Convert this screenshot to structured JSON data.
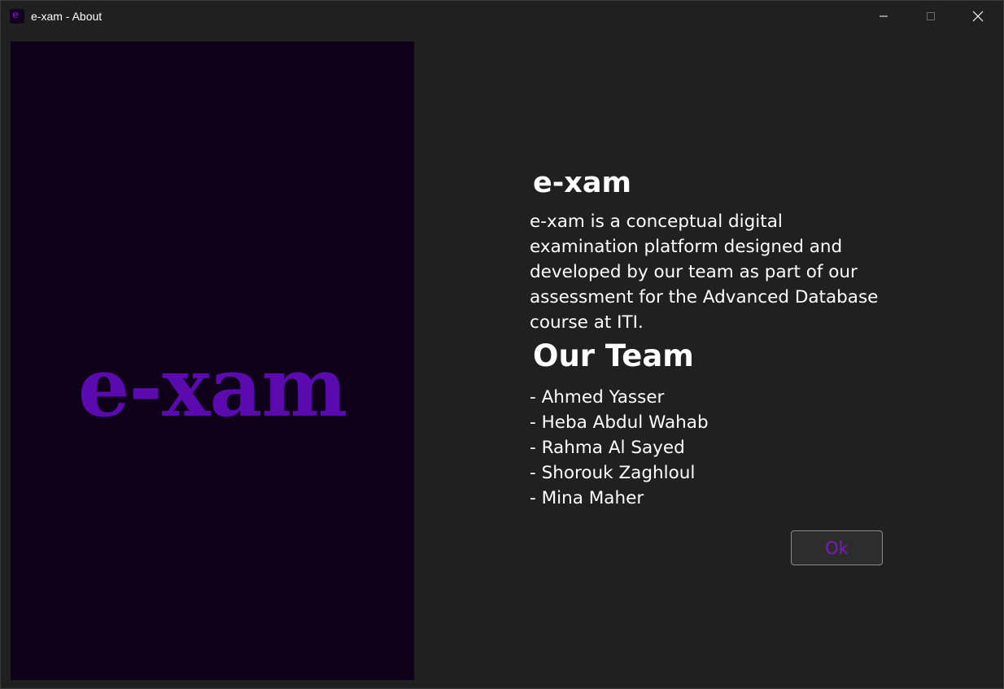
{
  "window": {
    "title": "e-xam - About",
    "app_icon_glyph": "e",
    "controls": [
      "minimize-icon",
      "maximize-icon",
      "close-icon"
    ]
  },
  "logo": {
    "text": "e-xam",
    "color": "#5b0ab0",
    "background": "#0f0119"
  },
  "about": {
    "title": "e-xam",
    "description": "e-xam is a conceptual digital examination platform designed and developed by our team as part of our assessment for the Advanced Database course at ITI."
  },
  "team": {
    "heading": "Our Team",
    "members": [
      "- Ahmed Yasser",
      "- Heba Abdul Wahab",
      "- Rahma Al Sayed",
      "- Shorouk Zaghloul",
      "- Mina Maher"
    ]
  },
  "actions": {
    "ok_label": "Ok",
    "ok_color": "#7a1cb8"
  }
}
